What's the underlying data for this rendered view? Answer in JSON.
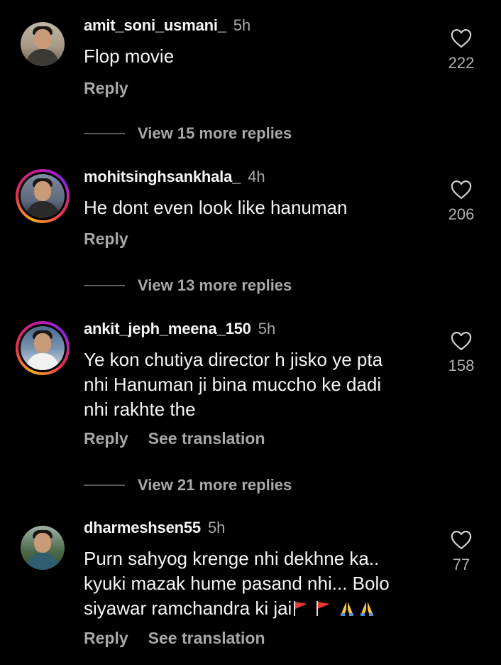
{
  "comments": [
    {
      "username": "amit_soni_usmani_",
      "time": "5h",
      "text": "Flop movie",
      "likes": "222",
      "reply_label": "Reply",
      "view_more": "View 15 more replies"
    },
    {
      "username": "mohitsinghsankhala_",
      "time": "4h",
      "text": "He dont even look like hanuman",
      "likes": "206",
      "reply_label": "Reply",
      "view_more": "View 13 more replies"
    },
    {
      "username": "ankit_jeph_meena_150",
      "time": "5h",
      "text_lines": [
        "Ye kon chutiya director h jisko ye pta",
        "nhi Hanuman ji bina muccho ke dadi",
        "nhi rakhte the"
      ],
      "likes": "158",
      "reply_label": "Reply",
      "see_translation": "See translation",
      "view_more": "View 21 more replies"
    },
    {
      "username": "dharmeshsen55",
      "time": "5h",
      "text_lines": [
        "Purn sahyog krenge nhi dekhne ka..",
        "kyuki mazak hume pasand nhi... Bolo",
        "siyawar ramchandra ki jai"
      ],
      "emoji_tail": "🚩🚩🙏🙏",
      "likes": "77",
      "reply_label": "Reply",
      "see_translation": "See translation"
    }
  ],
  "icons": {
    "like": "heart-outline-icon",
    "flag": "triangular-flag-icon",
    "pray": "folded-hands-icon"
  },
  "colors": {
    "background": "#000000",
    "primary_text": "#f5f5f5",
    "secondary_text": "#a8a8a8",
    "story_ring": [
      "#f9a825",
      "#e8304a",
      "#c3199e"
    ]
  }
}
